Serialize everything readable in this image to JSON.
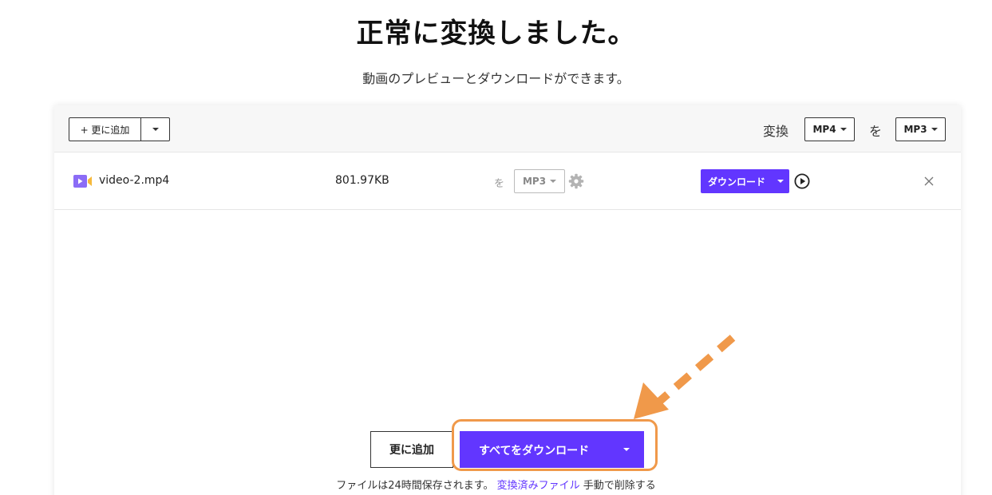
{
  "header": {
    "title": "正常に変換しました。",
    "subtitle": "動画のプレビューとダウンロードができます。"
  },
  "toolbar": {
    "add_more_label": "+ 更に追加",
    "convert_label": "変換",
    "from_format": "MP4",
    "connector": "を",
    "to_format": "MP3"
  },
  "files": [
    {
      "name": "video-2.mp4",
      "size": "801.97KB",
      "connector": "を",
      "format": "MP3",
      "download_label": "ダウンロード",
      "icon": "video-file-icon"
    }
  ],
  "footer": {
    "add_more_label": "更に追加",
    "download_all_label": "すべてをダウンロード",
    "note_before": "ファイルは24時間保存されます。",
    "note_link": "変換済みファイル",
    "note_after": "手動で削除する"
  },
  "colors": {
    "accent": "#6236ff",
    "highlight": "#f0994a",
    "header_bg": "#f7f7f7"
  }
}
